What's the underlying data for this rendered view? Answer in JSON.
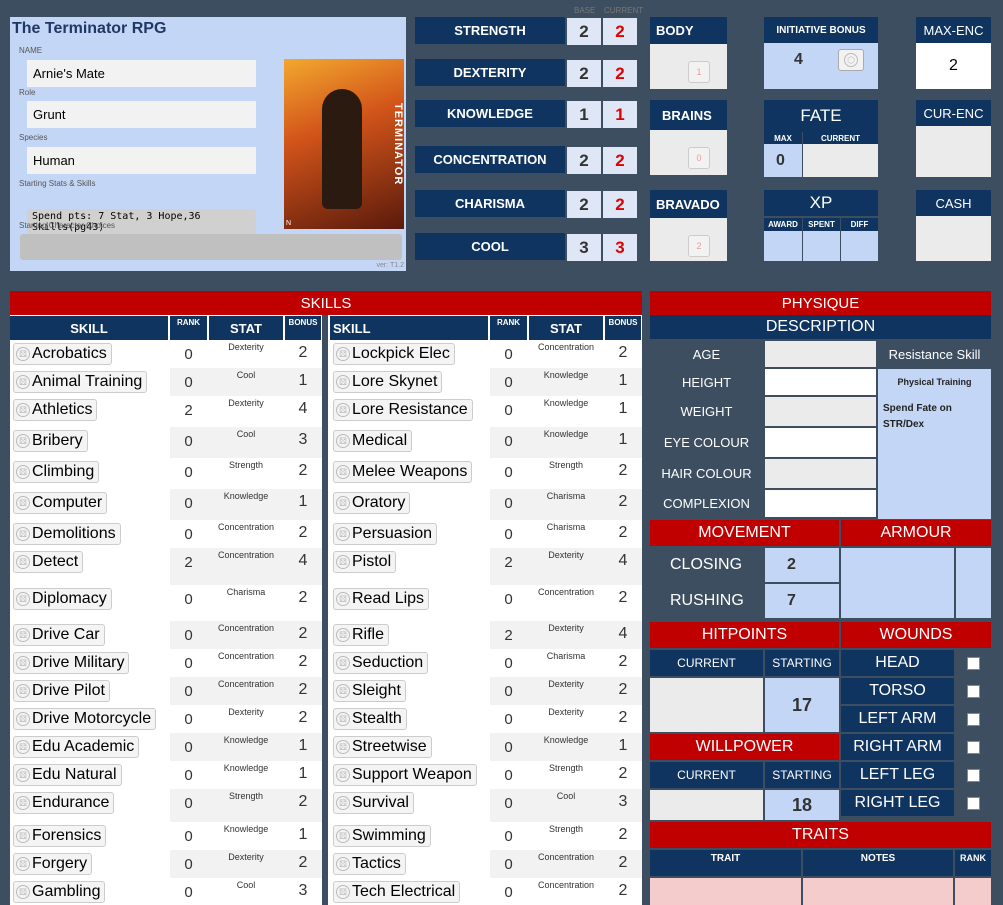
{
  "header": {
    "title": "The Terminator RPG",
    "name_label": "NAME",
    "name": "Arnie's Mate",
    "role_label": "Role",
    "role": "Grunt",
    "species_label": "Species",
    "species": "Human",
    "starting_label": "Starting Stats & Skills",
    "spend": "Spend pts: 7 Stat, 3 Hope,36 Skills(pg43)",
    "choices_label": "Starting Character Choices",
    "version": "ver: T1.2",
    "cover_text": "TERMINATOR",
    "cover_small": "N"
  },
  "stats_header": {
    "base": "BASE",
    "current": "CURRENT"
  },
  "stats": [
    {
      "name": "STRENGTH",
      "base": "2",
      "current": "2"
    },
    {
      "name": "DEXTERITY",
      "base": "2",
      "current": "2"
    },
    {
      "name": "KNOWLEDGE",
      "base": "1",
      "current": "1"
    },
    {
      "name": "CONCENTRATION",
      "base": "2",
      "current": "2"
    },
    {
      "name": "CHARISMA",
      "base": "2",
      "current": "2"
    },
    {
      "name": "COOL",
      "base": "3",
      "current": "3"
    }
  ],
  "derived": {
    "body": {
      "label": "BODY",
      "value": "1"
    },
    "brains": {
      "label": "BRAINS",
      "value": "0"
    },
    "bravado": {
      "label": "BRAVADO",
      "value": "2"
    }
  },
  "initiative": {
    "label": "INITIATIVE BONUS",
    "value": "4"
  },
  "fate": {
    "label": "FATE",
    "max_label": "MAX",
    "current_label": "CURRENT",
    "max": "0"
  },
  "xp": {
    "label": "XP",
    "award": "AWARD",
    "spent": "SPENT",
    "diff": "DIFF"
  },
  "maxenc": {
    "label": "MAX-ENC",
    "value": "2"
  },
  "curenc": {
    "label": "CUR-ENC"
  },
  "cash": {
    "label": "CASH"
  },
  "skills": {
    "title": "SKILLS",
    "col_skill": "SKILL",
    "col_rank": "RANK",
    "col_stat": "STAT",
    "col_bonus": "BONUS",
    "left": [
      {
        "name": "Acrobatics",
        "rank": "0",
        "stat": "Dexterity",
        "bonus": "2"
      },
      {
        "name": "Animal Training",
        "rank": "0",
        "stat": "Cool",
        "bonus": "1"
      },
      {
        "name": "Athletics",
        "rank": "2",
        "stat": "Dexterity",
        "bonus": "4"
      },
      {
        "name": "Bribery",
        "rank": "0",
        "stat": "Cool",
        "bonus": "3"
      },
      {
        "name": "Climbing",
        "rank": "0",
        "stat": "Strength",
        "bonus": "2"
      },
      {
        "name": "Computer",
        "rank": "0",
        "stat": "Knowledge",
        "bonus": "1"
      },
      {
        "name": "Demolitions",
        "rank": "0",
        "stat": "Concentration",
        "bonus": "2"
      },
      {
        "name": "Detect",
        "rank": "2",
        "stat": "Concentration",
        "bonus": "4"
      },
      {
        "name": "Diplomacy",
        "rank": "0",
        "stat": "Charisma",
        "bonus": "2"
      },
      {
        "name": "Drive Car",
        "rank": "0",
        "stat": "Concentration",
        "bonus": "2"
      },
      {
        "name": "Drive Military",
        "rank": "0",
        "stat": "Concentration",
        "bonus": "2"
      },
      {
        "name": "Drive Pilot",
        "rank": "0",
        "stat": "Concentration",
        "bonus": "2"
      },
      {
        "name": "Drive Motorcycle",
        "rank": "0",
        "stat": "Dexterity",
        "bonus": "2"
      },
      {
        "name": "Edu Academic",
        "rank": "0",
        "stat": "Knowledge",
        "bonus": "1"
      },
      {
        "name": "Edu Natural",
        "rank": "0",
        "stat": "Knowledge",
        "bonus": "1"
      },
      {
        "name": "Endurance",
        "rank": "0",
        "stat": "Strength",
        "bonus": "2"
      },
      {
        "name": "Forensics",
        "rank": "0",
        "stat": "Knowledge",
        "bonus": "1"
      },
      {
        "name": "Forgery",
        "rank": "0",
        "stat": "Dexterity",
        "bonus": "2"
      },
      {
        "name": "Gambling",
        "rank": "0",
        "stat": "Cool",
        "bonus": "3"
      }
    ],
    "right": [
      {
        "name": "Lockpick Elec",
        "rank": "0",
        "stat": "Concentration",
        "bonus": "2"
      },
      {
        "name": "Lore Skynet",
        "rank": "0",
        "stat": "Knowledge",
        "bonus": "1"
      },
      {
        "name": "Lore Resistance",
        "rank": "0",
        "stat": "Knowledge",
        "bonus": "1"
      },
      {
        "name": "Medical",
        "rank": "0",
        "stat": "Knowledge",
        "bonus": "1"
      },
      {
        "name": "Melee Weapons",
        "rank": "0",
        "stat": "Strength",
        "bonus": "2"
      },
      {
        "name": "Oratory",
        "rank": "0",
        "stat": "Charisma",
        "bonus": "2"
      },
      {
        "name": "Persuasion",
        "rank": "0",
        "stat": "Charisma",
        "bonus": "2"
      },
      {
        "name": "Pistol",
        "rank": "2",
        "stat": "Dexterity",
        "bonus": "4"
      },
      {
        "name": "Read Lips",
        "rank": "0",
        "stat": "Concentration",
        "bonus": "2"
      },
      {
        "name": "Rifle",
        "rank": "2",
        "stat": "Dexterity",
        "bonus": "4"
      },
      {
        "name": "Seduction",
        "rank": "0",
        "stat": "Charisma",
        "bonus": "2"
      },
      {
        "name": "Sleight",
        "rank": "0",
        "stat": "Dexterity",
        "bonus": "2"
      },
      {
        "name": "Stealth",
        "rank": "0",
        "stat": "Dexterity",
        "bonus": "2"
      },
      {
        "name": "Streetwise",
        "rank": "0",
        "stat": "Knowledge",
        "bonus": "1"
      },
      {
        "name": "Support Weapon",
        "rank": "0",
        "stat": "Strength",
        "bonus": "2"
      },
      {
        "name": "Survival",
        "rank": "0",
        "stat": "Cool",
        "bonus": "3"
      },
      {
        "name": "Swimming",
        "rank": "0",
        "stat": "Strength",
        "bonus": "2"
      },
      {
        "name": "Tactics",
        "rank": "0",
        "stat": "Concentration",
        "bonus": "2"
      },
      {
        "name": "Tech Electrical",
        "rank": "0",
        "stat": "Concentration",
        "bonus": "2"
      }
    ]
  },
  "physique": {
    "title": "PHYSIQUE",
    "description": "DESCRIPTION",
    "rows": [
      "AGE",
      "HEIGHT",
      "WEIGHT",
      "EYE COLOUR",
      "HAIR COLOUR",
      "COMPLEXION"
    ],
    "resistance_label": "Resistance Skill",
    "resistance_value": "Physical Training",
    "resistance_note": "Spend Fate on STR/Dex"
  },
  "movement": {
    "title": "MOVEMENT",
    "closing": "CLOSING",
    "closing_val": "2",
    "rushing": "RUSHING",
    "rushing_val": "7"
  },
  "armour": {
    "title": "ARMOUR"
  },
  "hitpoints": {
    "title": "HITPOINTS",
    "current": "CURRENT",
    "starting": "STARTING",
    "starting_val": "17"
  },
  "willpower": {
    "title": "WILLPOWER",
    "current": "CURRENT",
    "starting": "STARTING",
    "starting_val": "18"
  },
  "wounds": {
    "title": "WOUNDS",
    "parts": [
      "HEAD",
      "TORSO",
      "LEFT ARM",
      "RIGHT ARM",
      "LEFT LEG",
      "RIGHT LEG"
    ]
  },
  "traits": {
    "title": "TRAITS",
    "trait": "TRAIT",
    "notes": "NOTES",
    "rank": "RANK"
  }
}
